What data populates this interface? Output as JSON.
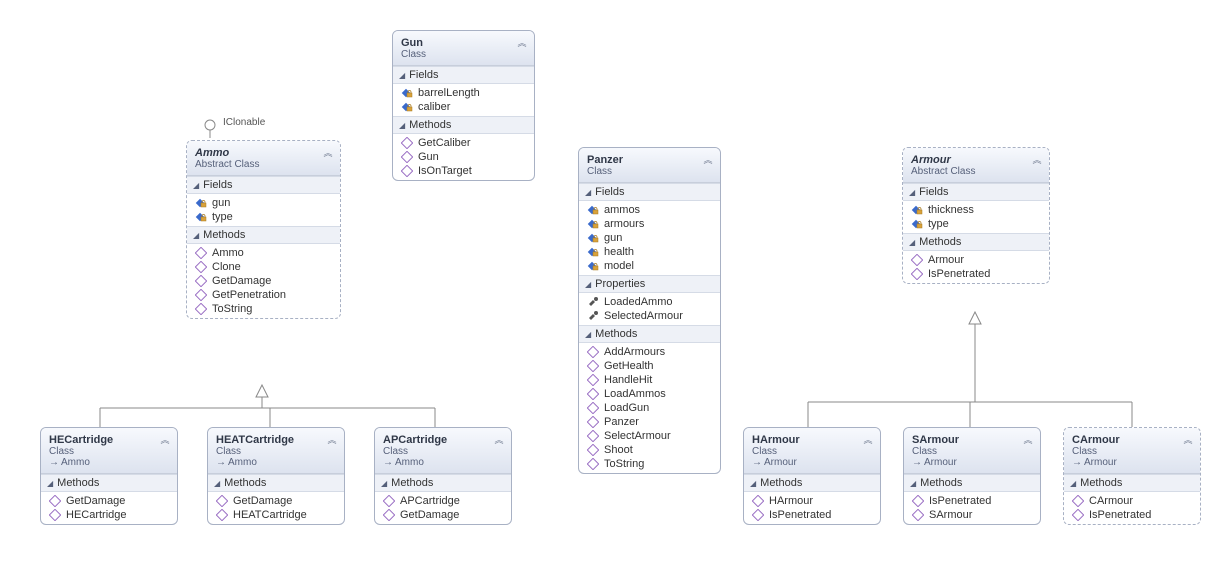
{
  "interface": "IClonable",
  "ammo": {
    "title": "Ammo",
    "sub": "Abstract Class",
    "fields": [
      "gun",
      "type"
    ],
    "methods": [
      "Ammo",
      "Clone",
      "GetDamage",
      "GetPenetration",
      "ToString"
    ]
  },
  "gun": {
    "title": "Gun",
    "sub": "Class",
    "fields": [
      "barrelLength",
      "caliber"
    ],
    "methods": [
      "GetCaliber",
      "Gun",
      "IsOnTarget"
    ]
  },
  "panzer": {
    "title": "Panzer",
    "sub": "Class",
    "fields": [
      "ammos",
      "armours",
      "gun",
      "health",
      "model"
    ],
    "props": [
      "LoadedAmmo",
      "SelectedArmour"
    ],
    "methods": [
      "AddArmours",
      "GetHealth",
      "HandleHit",
      "LoadAmmos",
      "LoadGun",
      "Panzer",
      "SelectArmour",
      "Shoot",
      "ToString"
    ]
  },
  "armour": {
    "title": "Armour",
    "sub": "Abstract Class",
    "fields": [
      "thickness",
      "type"
    ],
    "methods": [
      "Armour",
      "IsPenetrated"
    ]
  },
  "he": {
    "title": "HECartridge",
    "sub": "Class",
    "base": "Ammo",
    "methods": [
      "GetDamage",
      "HECartridge"
    ]
  },
  "heat": {
    "title": "HEATCartridge",
    "sub": "Class",
    "base": "Ammo",
    "methods": [
      "GetDamage",
      "HEATCartridge"
    ]
  },
  "ap": {
    "title": "APCartridge",
    "sub": "Class",
    "base": "Ammo",
    "methods": [
      "APCartridge",
      "GetDamage"
    ]
  },
  "ha": {
    "title": "HArmour",
    "sub": "Class",
    "base": "Armour",
    "methods": [
      "HArmour",
      "IsPenetrated"
    ]
  },
  "sa": {
    "title": "SArmour",
    "sub": "Class",
    "base": "Armour",
    "methods": [
      "IsPenetrated",
      "SArmour"
    ]
  },
  "ca": {
    "title": "CArmour",
    "sub": "Class",
    "base": "Armour",
    "methods": [
      "CArmour",
      "IsPenetrated"
    ]
  },
  "sec": {
    "fields": "Fields",
    "methods": "Methods",
    "props": "Properties"
  }
}
